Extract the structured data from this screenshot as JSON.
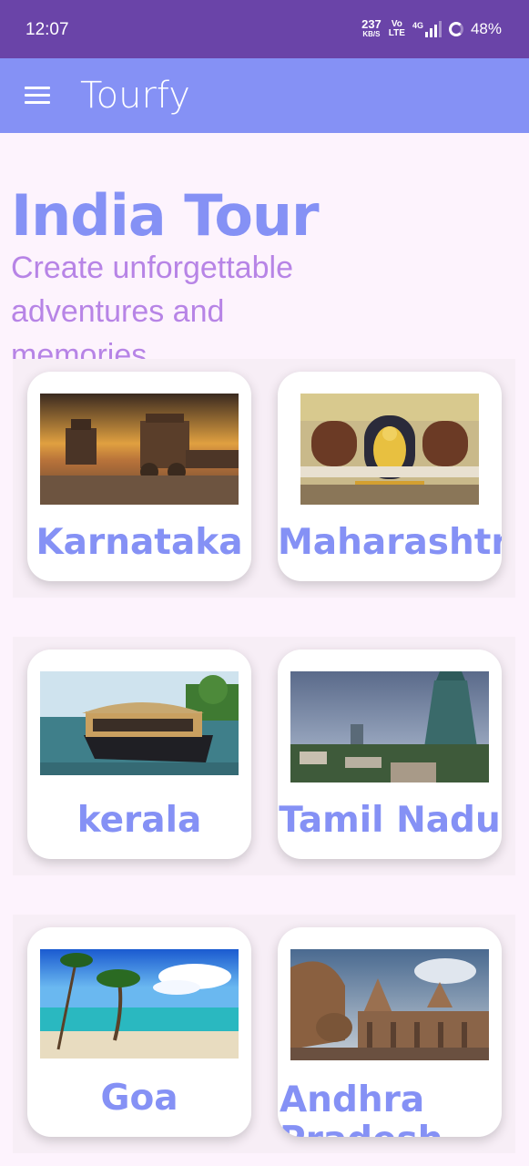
{
  "status_bar": {
    "time": "12:07",
    "net_speed_value": "237",
    "net_speed_unit": "KB/S",
    "volte_top": "Vo",
    "volte_bottom": "LTE",
    "signal_label": "4G",
    "battery": "48%"
  },
  "app_bar": {
    "title": "Tourfy",
    "menu_icon": "hamburger-menu-icon"
  },
  "header": {
    "title": "India Tour",
    "subtitle": "Create unforgettable adventures and memories"
  },
  "destinations": [
    {
      "label": "Karnataka",
      "image": "hampi-stone-chariot"
    },
    {
      "label": "Maharashtr",
      "image": "shirdi-sai-temple"
    },
    {
      "label": "kerala",
      "image": "kerala-houseboat"
    },
    {
      "label": "Tamil Nadu",
      "image": "madurai-temple-gopuram"
    },
    {
      "label": "Goa",
      "image": "goa-beach-palms"
    },
    {
      "label": "Andhra Pradesh",
      "image": "lepakshi-nandi-temple"
    }
  ],
  "colors": {
    "status_bar": "#6a44a8",
    "app_bar": "#8591f5",
    "title": "#8591f5",
    "subtitle": "#b784e6",
    "background": "#fdf3fd"
  }
}
